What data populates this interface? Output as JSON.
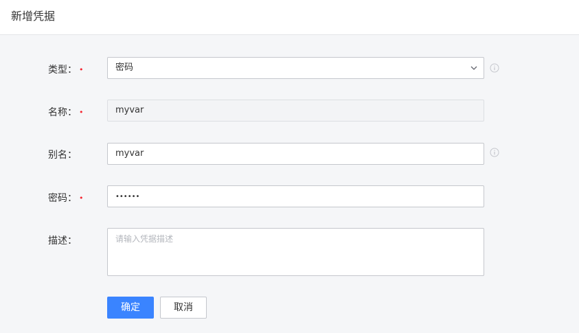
{
  "header": {
    "title": "新增凭据"
  },
  "form": {
    "type": {
      "label": "类型：",
      "required_mark": "•",
      "value": "密码"
    },
    "name": {
      "label": "名称：",
      "required_mark": "•",
      "value": "myvar"
    },
    "alias": {
      "label": "别名：",
      "value": "myvar"
    },
    "password": {
      "label": "密码：",
      "required_mark": "•",
      "value": "••••••"
    },
    "description": {
      "label": "描述：",
      "placeholder": "请输入凭据描述"
    }
  },
  "actions": {
    "confirm_label": "确定",
    "cancel_label": "取消"
  },
  "colors": {
    "primary": "#3a84ff",
    "required": "#f5222d",
    "border": "#c4c6cc"
  },
  "icons": [
    "chevron-down-icon",
    "info-icon"
  ]
}
